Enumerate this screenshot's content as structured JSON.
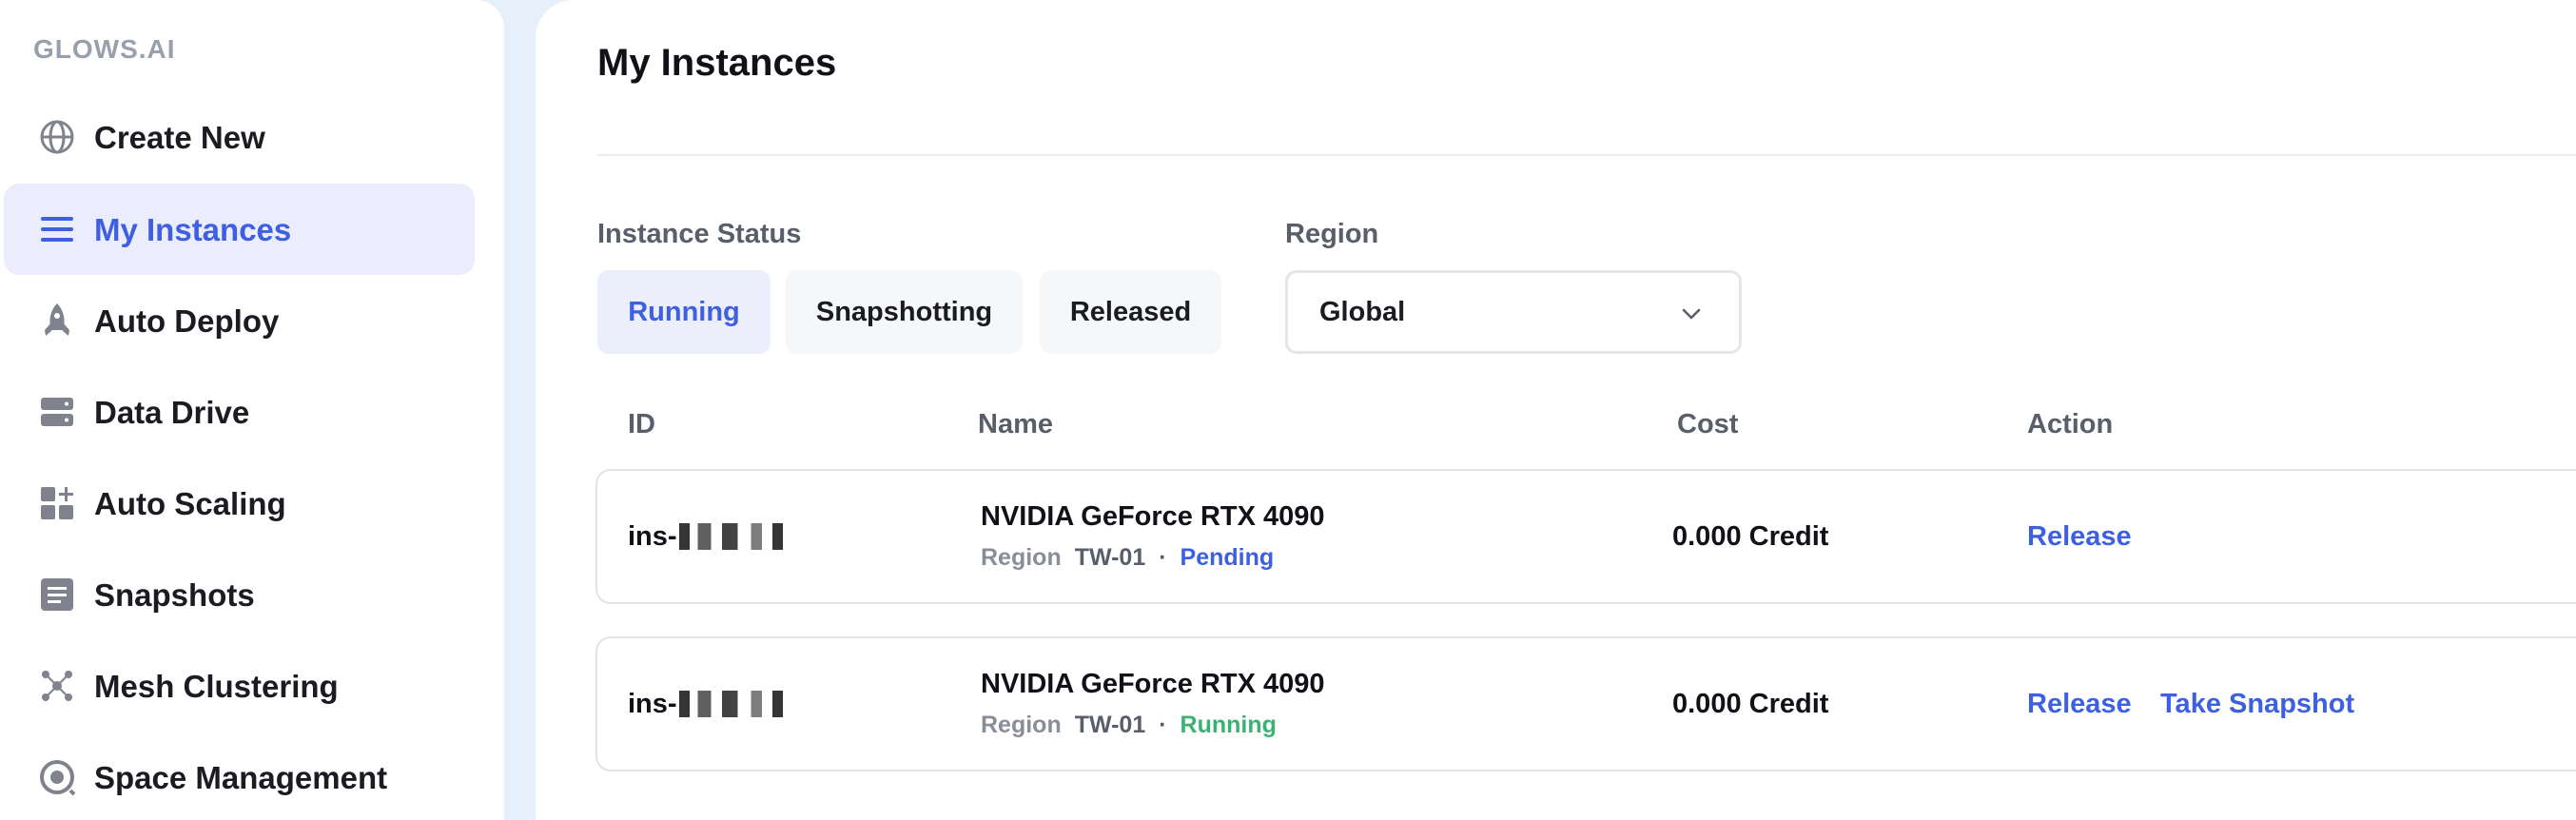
{
  "brand": "GLOWS.AI",
  "sidebar": {
    "items": [
      {
        "label": "Create New",
        "icon": "globe-icon",
        "active": false
      },
      {
        "label": "My Instances",
        "icon": "list-icon",
        "active": true
      },
      {
        "label": "Auto Deploy",
        "icon": "rocket-icon",
        "active": false
      },
      {
        "label": "Data Drive",
        "icon": "drive-icon",
        "active": false
      },
      {
        "label": "Auto Scaling",
        "icon": "grid-plus-icon",
        "active": false
      },
      {
        "label": "Snapshots",
        "icon": "snapshot-icon",
        "active": false
      },
      {
        "label": "Mesh Clustering",
        "icon": "mesh-icon",
        "active": false
      },
      {
        "label": "Space Management",
        "icon": "space-icon",
        "active": false
      }
    ]
  },
  "main": {
    "title": "My Instances",
    "filters": {
      "status_label": "Instance Status",
      "status_options": [
        "Running",
        "Snapshotting",
        "Released"
      ],
      "status_selected": "Running",
      "region_label": "Region",
      "region_value": "Global"
    },
    "table": {
      "columns": [
        "ID",
        "Name",
        "Cost",
        "Action"
      ],
      "rows": [
        {
          "id_prefix": "ins-",
          "name": "NVIDIA GeForce RTX 4090",
          "region_label": "Region",
          "region": "TW-01",
          "separator": "·",
          "status": "Pending",
          "cost": "0.000 Credit",
          "actions": [
            "Release"
          ]
        },
        {
          "id_prefix": "ins-",
          "name": "NVIDIA GeForce RTX 4090",
          "region_label": "Region",
          "region": "TW-01",
          "separator": "·",
          "status": "Running",
          "cost": "0.000 Credit",
          "actions": [
            "Release",
            "Take Snapshot"
          ]
        }
      ]
    }
  },
  "colors": {
    "accent": "#3d5fe0",
    "running": "#3bb273",
    "page_bg": "#e6f0fb"
  }
}
